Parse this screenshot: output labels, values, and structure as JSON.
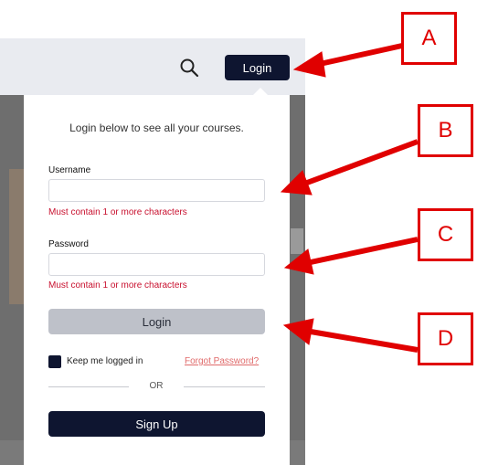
{
  "header": {
    "login_label": "Login"
  },
  "panel": {
    "intro": "Login below to see all your courses.",
    "username": {
      "label": "Username",
      "value": "",
      "placeholder": "",
      "error": "Must contain 1 or more characters"
    },
    "password": {
      "label": "Password",
      "value": "",
      "placeholder": "",
      "error": "Must contain 1 or more characters"
    },
    "login_button": "Login",
    "keep_logged_in": {
      "label": "Keep me logged in",
      "checked": true
    },
    "forgot_password": "Forgot Password?",
    "divider_text": "OR",
    "signup_button": "Sign Up"
  },
  "annotations": {
    "labels": [
      "A",
      "B",
      "C",
      "D"
    ],
    "color": "#e00000"
  },
  "colors": {
    "navy": "#0e1530",
    "error": "#c8102e",
    "link": "#e06a6a",
    "disabled_button": "#bec1c9"
  },
  "icons": {
    "search": "search-icon",
    "caret": "caret-up-icon"
  }
}
